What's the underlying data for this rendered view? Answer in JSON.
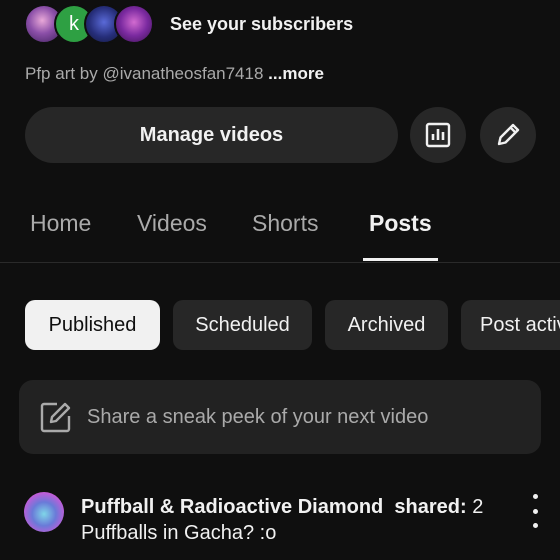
{
  "subscribers": {
    "avatars": [
      {
        "name": "subscriber-avatar-1",
        "glyph": ""
      },
      {
        "name": "subscriber-avatar-2",
        "glyph": "k"
      },
      {
        "name": "subscriber-avatar-3",
        "glyph": ""
      },
      {
        "name": "subscriber-avatar-4",
        "glyph": ""
      }
    ],
    "link_label": "See your subscribers"
  },
  "bio": {
    "text": "Pfp art by @ivanatheosfan7418",
    "more_label": "...more"
  },
  "actions": {
    "manage_label": "Manage videos",
    "analytics_icon": "analytics-icon",
    "edit_icon": "pencil-icon"
  },
  "tabs": [
    {
      "label": "Home",
      "active": false
    },
    {
      "label": "Videos",
      "active": false
    },
    {
      "label": "Shorts",
      "active": false
    },
    {
      "label": "Posts",
      "active": true
    }
  ],
  "filters": [
    {
      "label": "Published",
      "selected": true
    },
    {
      "label": "Scheduled",
      "selected": false
    },
    {
      "label": "Archived",
      "selected": false
    },
    {
      "label": "Post activity",
      "selected": false
    }
  ],
  "share_box": {
    "placeholder": "Share a sneak peek of your next video",
    "icon": "compose-icon"
  },
  "post": {
    "author": "Puffball & Radioactive Diamond",
    "shared_label": "shared:",
    "body": "2 Puffballs in Gacha? :o"
  },
  "colors": {
    "background": "#0f0f0f",
    "surface": "#272727",
    "text_primary": "#f1f1f1",
    "text_secondary": "#aaaaaa"
  }
}
